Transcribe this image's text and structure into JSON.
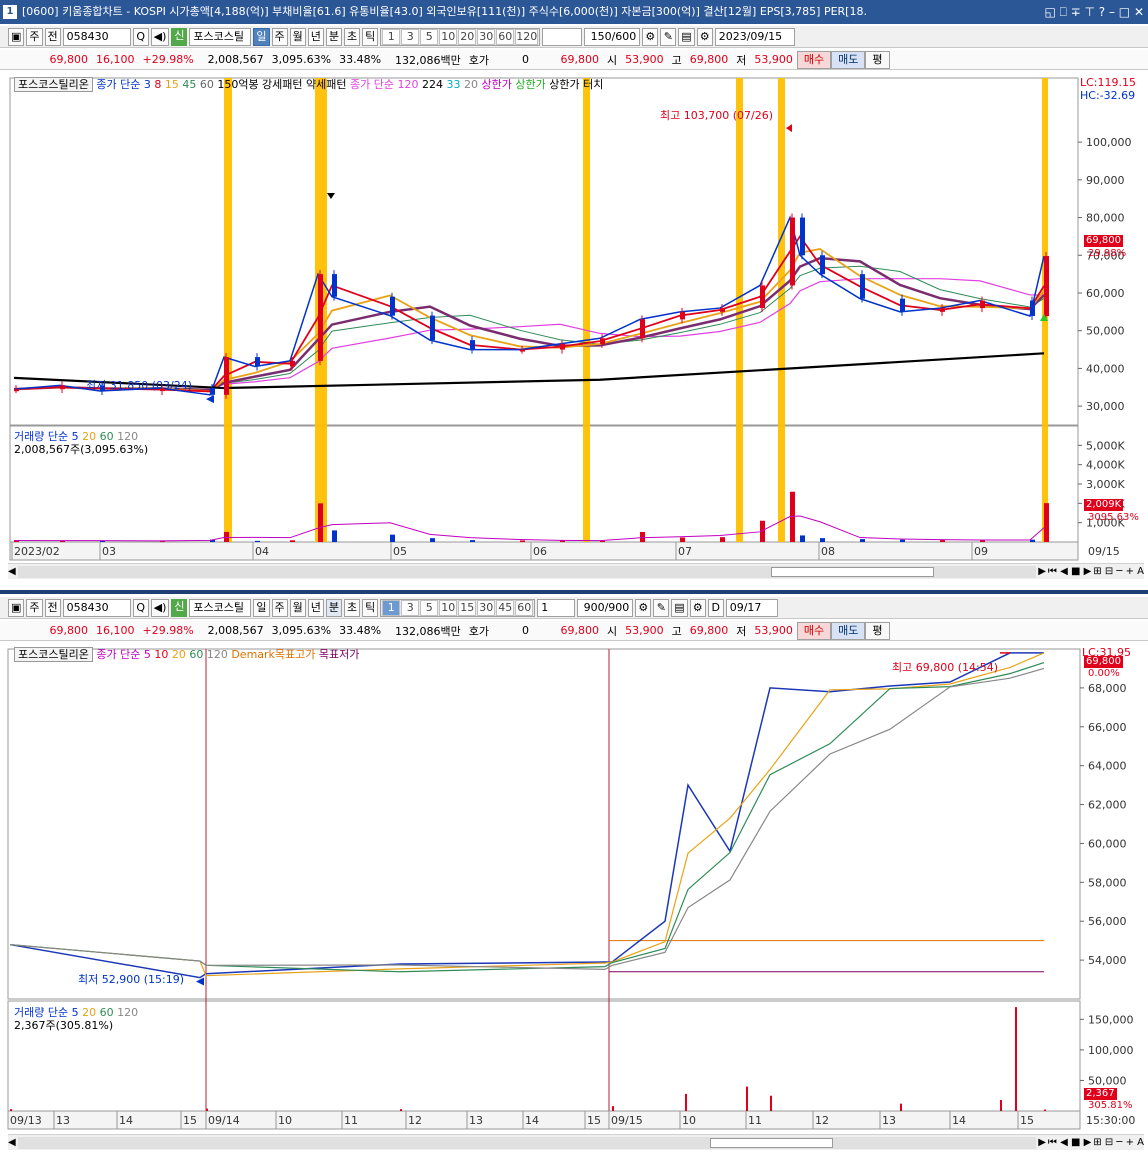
{
  "window": {
    "num": "1",
    "title": "[0600] 키움종합차트 - KOSPI 시가총액[4,188(억)] 부채비율[61.6] 유통비율[43.0] 외국인보유[111(천)] 주식수[6,000(천)] 자본금[300(억)] 결산[12월] EPS[3,785] PER[18.",
    "btns": "◱ ⎕ ∓ ⊤ ?  –  □  ✕"
  },
  "top": {
    "toolbar": {
      "type": "주",
      "prev": "전",
      "code": "058430",
      "search": "Q",
      "sin": "신",
      "name": "포스코스틸",
      "periods": [
        "일",
        "주",
        "월",
        "년",
        "분",
        "초",
        "틱"
      ],
      "active": "일",
      "nums": [
        "1",
        "3",
        "5",
        "10",
        "20",
        "30",
        "60",
        "120"
      ],
      "count": "150/600",
      "date": "2023/09/15"
    },
    "price": {
      "price": "69,800",
      "change": "16,100",
      "rate": "+29.98%",
      "volume": "2,008,567",
      "volrate": "3,095.63%",
      "turnover": "33.48%",
      "amount": "132,086백만",
      "hoga": "호가",
      "hogaval": "0",
      "cur": "69,800",
      "open_l": "시",
      "open": "53,900",
      "high_l": "고",
      "high": "69,800",
      "low_l": "저",
      "low": "53,900",
      "buy": "매수",
      "sell": "매도",
      "eq": "평"
    },
    "legend": [
      "포스코스틸리온",
      "종가 단순 3",
      "8",
      "15",
      "45",
      "60",
      "150억봉 강세패턴",
      "약세패턴",
      "종가 단순 120",
      "224",
      "33",
      "20",
      "상한가",
      "상한가",
      "상한가 터치"
    ],
    "lc": "LC:119.15",
    "hc": "HC:-32.69",
    "annot_high": "최고 103,700 (07/26)",
    "annot_low": "최저 31,850 (03/24)",
    "price_label": "69,800",
    "price_rate": "29.98%",
    "vol_legend": [
      "거래량",
      "단순 5",
      "20",
      "60",
      "120"
    ],
    "vol_value": "2,008,567주(3,095.63%)",
    "vol_label": "2,009K",
    "vol_rate": "3095.63%",
    "yticks": [
      "100,000",
      "90,000",
      "80,000",
      "70,000",
      "60,000",
      "50,000",
      "40,000",
      "30,000"
    ],
    "vticks": [
      "5,000K",
      "4,000K",
      "3,000K",
      "2,000K",
      "1,000K"
    ],
    "xticks": [
      "2023/02",
      "03",
      "04",
      "05",
      "06",
      "07",
      "08",
      "09"
    ],
    "last_date": "09/15"
  },
  "bottom": {
    "toolbar": {
      "type": "주",
      "prev": "전",
      "code": "058430",
      "sin": "신",
      "name": "포스코스틸",
      "periods": [
        "일",
        "주",
        "월",
        "년",
        "분",
        "초",
        "틱"
      ],
      "active": "분",
      "nums": [
        "1",
        "3",
        "5",
        "10",
        "15",
        "30",
        "45",
        "60"
      ],
      "interval": "1",
      "count": "900/900",
      "d": "D",
      "date": "09/17"
    },
    "price": {
      "price": "69,800",
      "change": "16,100",
      "rate": "+29.98%",
      "volume": "2,008,567",
      "volrate": "3,095.63%",
      "turnover": "33.48%",
      "amount": "132,086백만",
      "hoga": "호가",
      "hogaval": "0",
      "cur": "69,800",
      "open_l": "시",
      "open": "53,900",
      "high_l": "고",
      "high": "69,800",
      "low_l": "저",
      "low": "53,900",
      "buy": "매수",
      "sell": "매도",
      "eq": "평"
    },
    "legend": [
      "포스코스틸리온",
      "종가 단순 5",
      "10",
      "20",
      "60",
      "120",
      "Demark목표고가",
      "목표저가"
    ],
    "lc": "LC:31.95",
    "annot_high": "최고 69,800 (14:54)",
    "annot_low": "최저 52,900 (15:19)",
    "price_label": "69,800",
    "price_rate": "0.00%",
    "vol_legend": [
      "거래량",
      "단순 5",
      "20",
      "60",
      "120"
    ],
    "vol_value": "2,367주(305.81%)",
    "vol_label": "2,367",
    "vol_rate": "305.81%",
    "yticks": [
      "68,000",
      "66,000",
      "64,000",
      "62,000",
      "60,000",
      "58,000",
      "56,000",
      "54,000"
    ],
    "vticks": [
      "150,000",
      "100,000",
      "50,000"
    ],
    "xticks": [
      "09/13",
      "13",
      "14",
      "15",
      "09/14",
      "10",
      "11",
      "12",
      "13",
      "14",
      "15",
      "09/15",
      "10",
      "11",
      "12",
      "13",
      "14",
      "15"
    ],
    "last_time": "15:30:00"
  },
  "colors": {
    "up": "#e0001b",
    "down": "#0033cc",
    "ma3": "#e0001b",
    "ma8": "#0033cc",
    "ma15": "#e8a317",
    "ma45": "#7a2d6e",
    "ma60": "#2e8b57",
    "ma120": "#e040e0",
    "ma224": "#000000",
    "hl": "#ffc000"
  },
  "chart_data": [
    {
      "type": "candlestick",
      "title": "포스코스틸리온 일봉",
      "x": [
        "02-01",
        "02-15",
        "03-01",
        "03-15",
        "03-24",
        "04-03",
        "04-10",
        "04-17",
        "04-20",
        "04-25",
        "05-02",
        "05-10",
        "05-20",
        "06-01",
        "06-10",
        "06-20",
        "07-03",
        "07-10",
        "07-18",
        "07-20",
        "07-26",
        "07-31",
        "08-07",
        "08-15",
        "08-22",
        "09-01",
        "09-08",
        "09-14",
        "09-15"
      ],
      "close": [
        34500,
        35500,
        34000,
        34800,
        33000,
        43000,
        40500,
        42000,
        65000,
        59000,
        54000,
        47500,
        45000,
        45000,
        46500,
        48000,
        53000,
        55000,
        56000,
        62000,
        80000,
        70000,
        65000,
        58500,
        55000,
        56000,
        58000,
        53900,
        69800
      ],
      "ylim": [
        25000,
        117000
      ],
      "high": 103700,
      "low": 31850,
      "volume_k": [
        80,
        60,
        70,
        50,
        130,
        520,
        60,
        90,
        2000,
        600,
        380,
        200,
        100,
        80,
        70,
        60,
        520,
        230,
        250,
        1100,
        2600,
        340,
        200,
        150,
        120,
        100,
        90,
        120,
        2009
      ]
    },
    {
      "type": "line",
      "title": "포스코스틸리온 1분봉",
      "x": [
        "09/13 09:00",
        "09/13 15:19",
        "09/14 09:00",
        "09/14 12:00",
        "09/14 15:30",
        "09/15 09:00",
        "09/15 09:40",
        "09/15 10:00",
        "09/15 10:30",
        "09/15 11:00",
        "09/15 12:00",
        "09/15 13:00",
        "09/15 14:00",
        "09/15 14:54",
        "09/15 15:30"
      ],
      "close": [
        54800,
        53100,
        53300,
        53800,
        53900,
        53900,
        56000,
        63000,
        59600,
        68000,
        67800,
        68100,
        68300,
        69800,
        69800
      ],
      "ylim": [
        52000,
        70000
      ],
      "high": 69800,
      "low": 52900,
      "demark_high": 55000,
      "demark_low": 53400
    }
  ]
}
